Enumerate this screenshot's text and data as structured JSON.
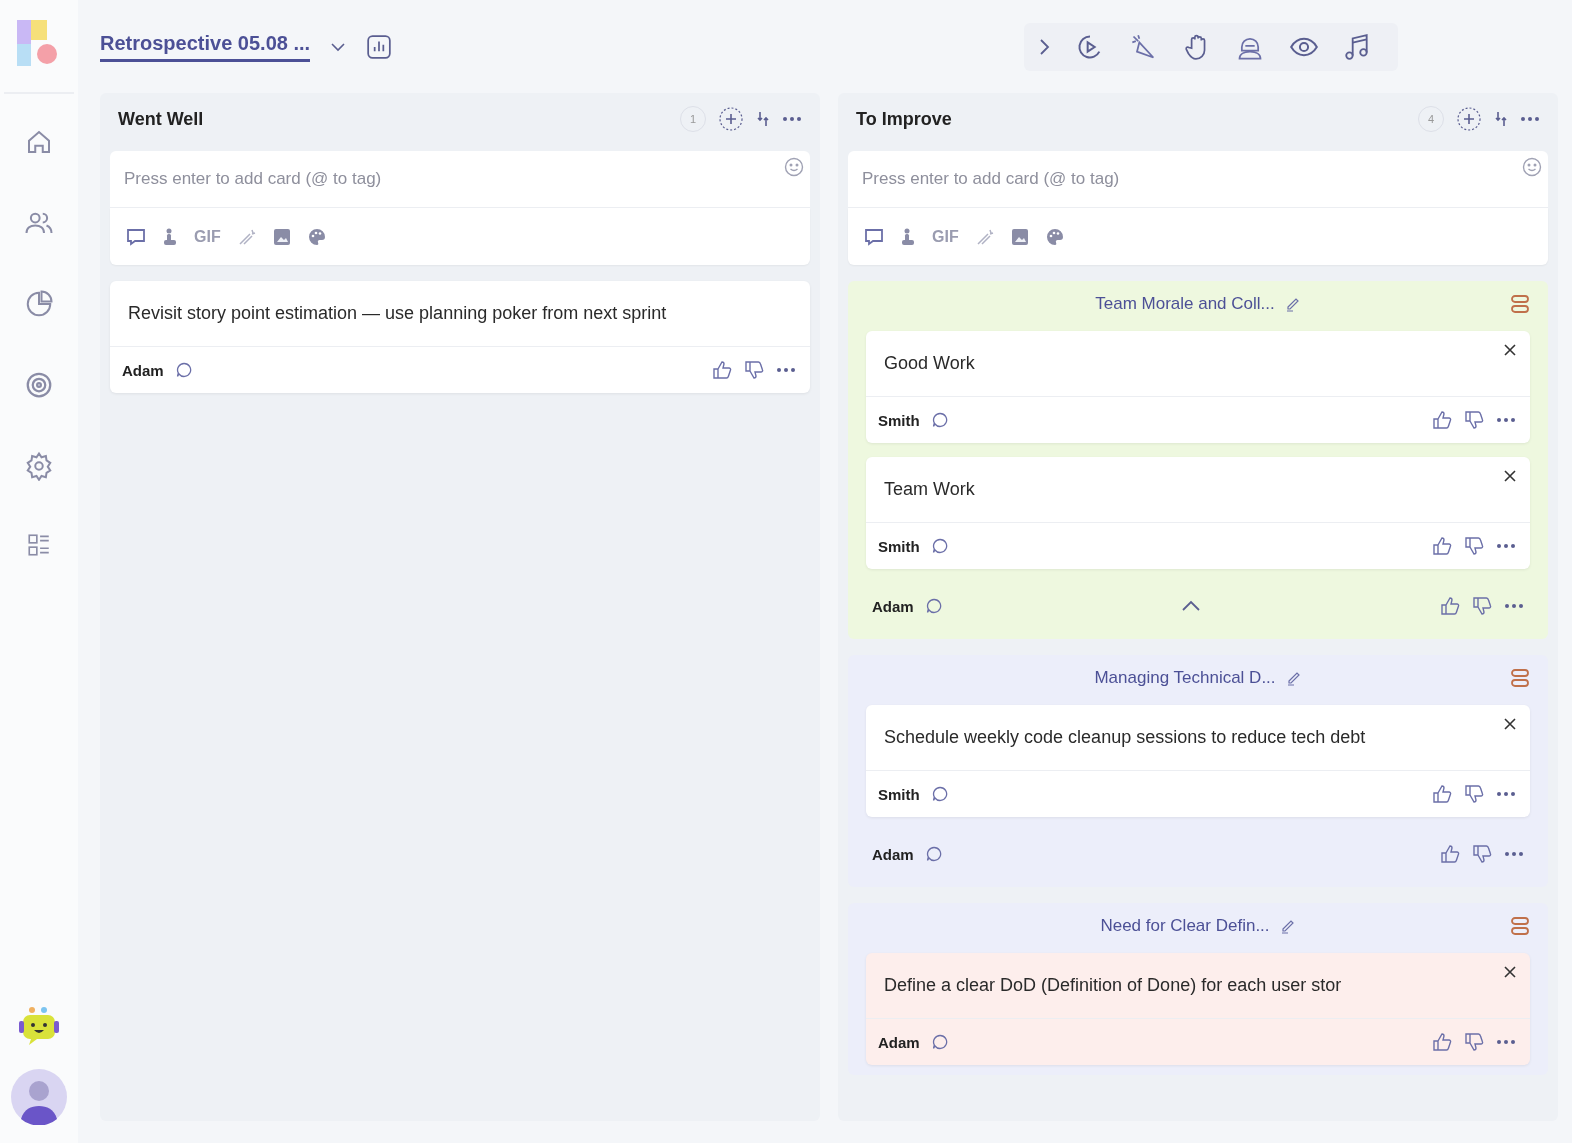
{
  "board": {
    "title": "Retrospective 05.08 ..."
  },
  "columns": [
    {
      "title": "Went Well",
      "count": "1",
      "composer": {
        "placeholder": "Press enter to add card (@ to tag)",
        "gif_label": "GIF"
      },
      "items": [
        {
          "kind": "card",
          "text": "Revisit story point estimation — use planning poker from next sprint",
          "author": "Adam"
        }
      ]
    },
    {
      "title": "To Improve",
      "count": "4",
      "composer": {
        "placeholder": "Press enter to add card (@ to tag)",
        "gif_label": "GIF"
      },
      "items": [
        {
          "kind": "group",
          "title": "Team Morale and Coll...",
          "color": "#eef8df",
          "author": "Adam",
          "expanded": true,
          "cards": [
            {
              "text": "Good Work",
              "author": "Smith",
              "color": "#ffffff"
            },
            {
              "text": "Team Work",
              "author": "Smith",
              "color": "#ffffff"
            }
          ]
        },
        {
          "kind": "group",
          "title": "Managing Technical D...",
          "color": "#eceefa",
          "author": "Adam",
          "cards": [
            {
              "text": "Schedule weekly code cleanup sessions to reduce tech debt",
              "author": "Smith",
              "color": "#ffffff"
            }
          ]
        },
        {
          "kind": "group",
          "title": "Need for Clear Defin...",
          "color": "#eceefa",
          "cards": [
            {
              "text": "Define a clear DoD (Definition of Done) for each user stor",
              "author": "Adam",
              "color": "#fdeeec"
            }
          ]
        }
      ]
    }
  ]
}
